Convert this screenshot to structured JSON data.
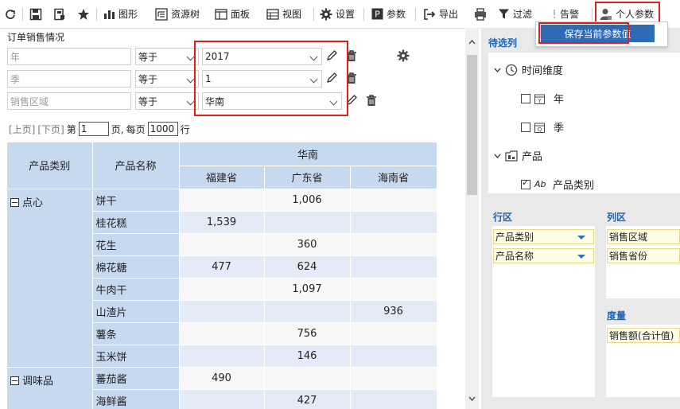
{
  "toolbar": {
    "items": [
      {
        "label": "图形",
        "icon": "bar-chart-icon"
      },
      {
        "label": "资源树",
        "icon": "resource-tree-icon"
      },
      {
        "label": "面板",
        "icon": "panel-icon"
      },
      {
        "label": "视图",
        "icon": "view-icon"
      },
      {
        "label": "设置",
        "icon": "gear-icon"
      },
      {
        "label": "参数",
        "icon": "param-icon"
      },
      {
        "label": "导出",
        "icon": "export-icon"
      },
      {
        "label": "过滤",
        "icon": "filter-icon"
      },
      {
        "label": "告警",
        "icon": "alert-icon"
      },
      {
        "label": "个人参数",
        "icon": "user-param-icon"
      }
    ],
    "popup_action": "保存当前参数值"
  },
  "report": {
    "title": "订单销售情况",
    "filters": [
      {
        "placeholder": "年",
        "op": "等于",
        "value": "2017"
      },
      {
        "placeholder": "季",
        "op": "等于",
        "value": "1"
      },
      {
        "placeholder": "销售区域",
        "op": "等于",
        "value": "华南"
      }
    ],
    "pager": {
      "prev": "[上页]",
      "next": "[下页]",
      "page_prefix": "第",
      "page": "1",
      "page_suffix": "页,",
      "per_prefix": "每页",
      "per_page": "1000",
      "per_suffix": "行"
    }
  },
  "table": {
    "col_category": "产品类别",
    "col_name": "产品名称",
    "region": "华南",
    "provinces": [
      "福建省",
      "广东省",
      "海南省"
    ],
    "groups": [
      {
        "category": "点心",
        "rows": [
          {
            "name": "饼干",
            "v": [
              "",
              "1,006",
              ""
            ]
          },
          {
            "name": "桂花糕",
            "v": [
              "1,539",
              "",
              ""
            ]
          },
          {
            "name": "花生",
            "v": [
              "",
              "360",
              ""
            ]
          },
          {
            "name": "棉花糖",
            "v": [
              "477",
              "624",
              ""
            ]
          },
          {
            "name": "牛肉干",
            "v": [
              "",
              "1,097",
              ""
            ]
          },
          {
            "name": "山渣片",
            "v": [
              "",
              "",
              "936"
            ]
          },
          {
            "name": "薯条",
            "v": [
              "",
              "756",
              ""
            ]
          },
          {
            "name": "玉米饼",
            "v": [
              "",
              "146",
              ""
            ]
          }
        ]
      },
      {
        "category": "调味品",
        "rows": [
          {
            "name": "蕃茄酱",
            "v": [
              "490",
              "",
              ""
            ]
          },
          {
            "name": "海鲜酱",
            "v": [
              "",
              "427",
              ""
            ]
          }
        ]
      }
    ]
  },
  "right_panel": {
    "candidates_title": "待选列",
    "tree": [
      {
        "label": "时间维度",
        "type": "folder"
      },
      {
        "label": "年",
        "type": "field",
        "checked": false
      },
      {
        "label": "季",
        "type": "field",
        "checked": false
      },
      {
        "label": "产品",
        "type": "folder"
      },
      {
        "label": "产品类别",
        "type": "field",
        "checked": true
      }
    ],
    "rows_title": "行区",
    "rows": [
      "产品类别",
      "产品名称"
    ],
    "cols_title": "列区",
    "cols": [
      "销售区域",
      "销售省份"
    ],
    "measure_title": "度量",
    "measures": [
      "销售额(合计值)"
    ]
  },
  "colors": {
    "accent": "#2f6ab5",
    "highlight": "#e01e1e",
    "header_bg": "#c7d9ee",
    "link": "#1b63b4"
  }
}
